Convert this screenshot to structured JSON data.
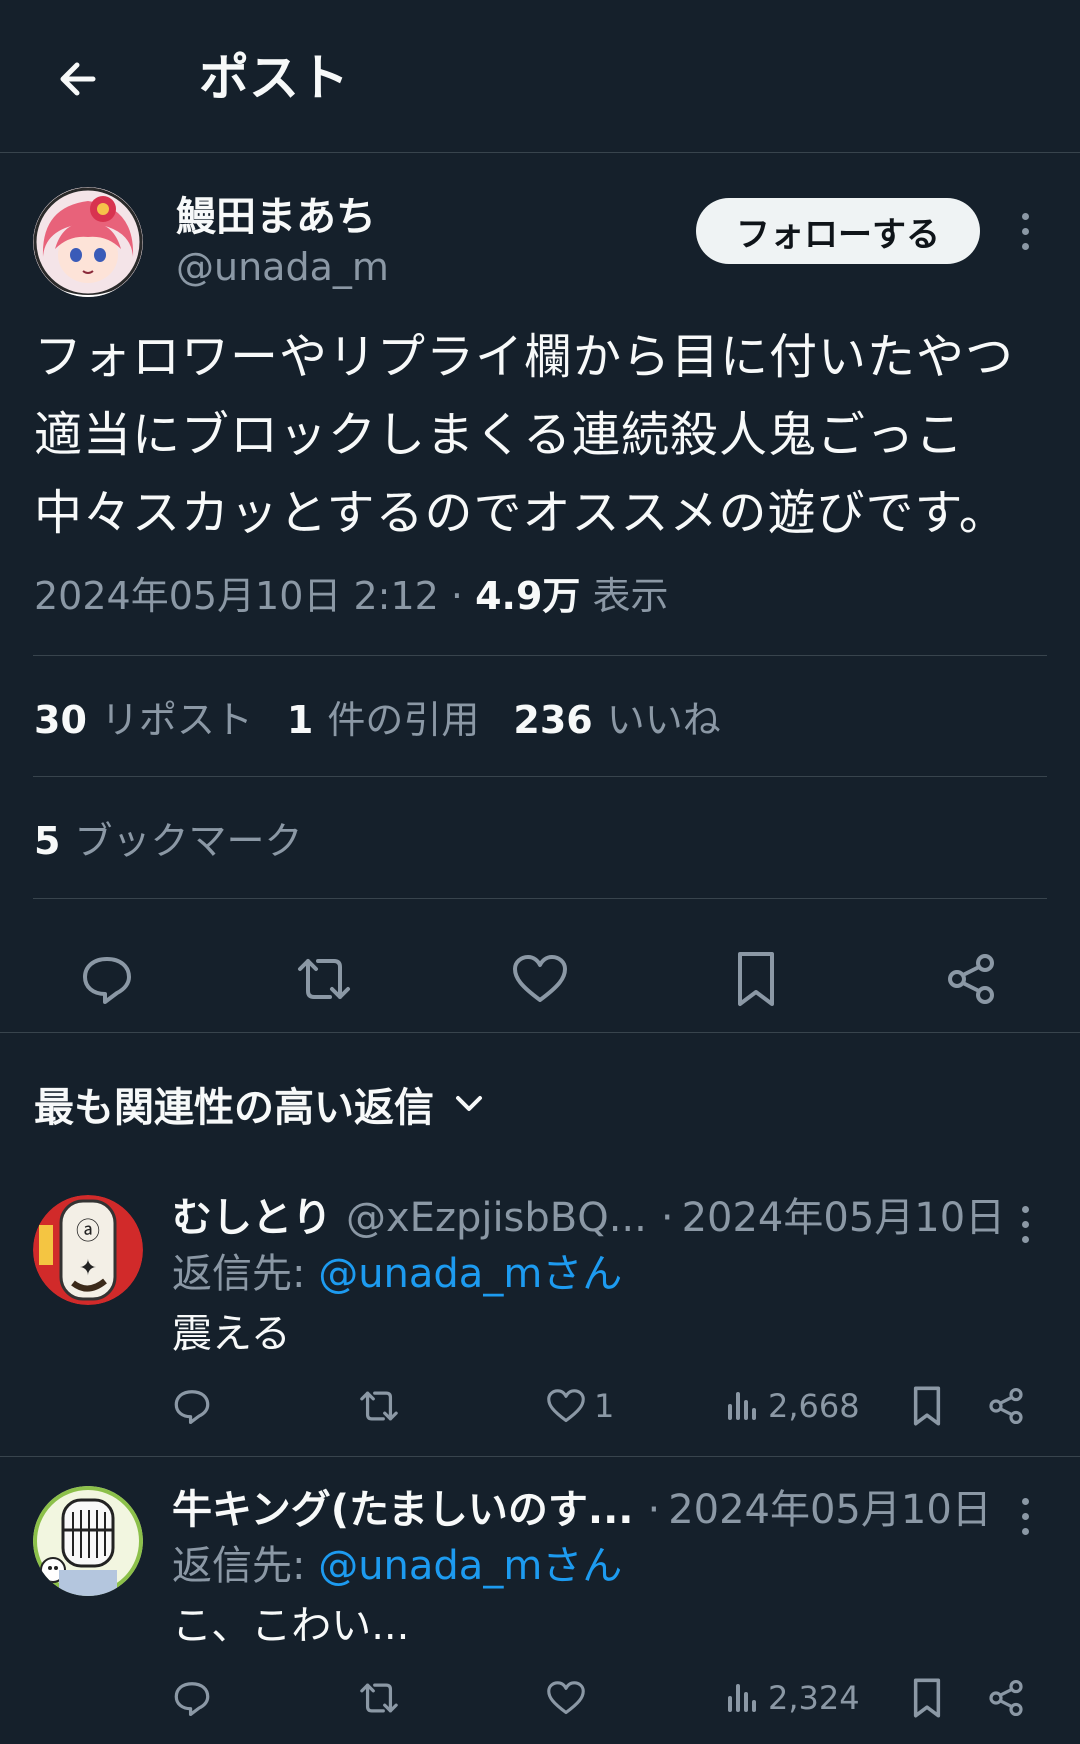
{
  "header": {
    "title": "ポスト"
  },
  "post": {
    "author_name": "鰻田まあち",
    "author_handle": "@unada_m",
    "follow_label": "フォローする",
    "text": "フォロワーやリプライ欄から目に付いたやつ適当にブロックしまくる連続殺人鬼ごっこ中々スカッとするのでオススメの遊びです。",
    "datetime": "2024年05月10日 2:12",
    "dot": "·",
    "views_count": "4.9万",
    "views_label": "表示",
    "reposts_count": "30",
    "reposts_label": "リポスト",
    "quotes_count": "1",
    "quotes_label": "件の引用",
    "likes_count": "236",
    "likes_label": "いいね",
    "bookmarks_count": "5",
    "bookmarks_label": "ブックマーク"
  },
  "replies_sort": {
    "label": "最も関連性の高い返信"
  },
  "replies": [
    {
      "name": "むしとり",
      "handle": "@xEzpjisbBQ...",
      "dot": "·",
      "date": "2024年05月10日",
      "reply_to_label": "返信先: ",
      "reply_to_mention": "@unada_mさん",
      "text": "震える",
      "likes": "1",
      "views": "2,668"
    },
    {
      "name": "牛キング(たましいのす...",
      "handle": "",
      "dot": "·",
      "date": "2024年05月10日",
      "reply_to_label": "返信先: ",
      "reply_to_mention": "@unada_mさん",
      "text": "こ、こわい...",
      "likes": "",
      "views": "2,324"
    }
  ],
  "colors": {
    "background": "#15202b",
    "divider": "#38444d",
    "text_primary": "#f7f9f9",
    "text_secondary": "#8b98a5",
    "accent": "#1d9bf0",
    "follow_button_bg": "#eff3f4"
  },
  "icons": {
    "back": "arrow-left-icon",
    "more": "more-vertical-icon",
    "reply": "speech-bubble-icon",
    "repost": "repost-icon",
    "like": "heart-icon",
    "bookmark": "bookmark-icon",
    "share": "share-icon",
    "views": "bar-chart-icon",
    "sort": "chevron-down-icon"
  }
}
